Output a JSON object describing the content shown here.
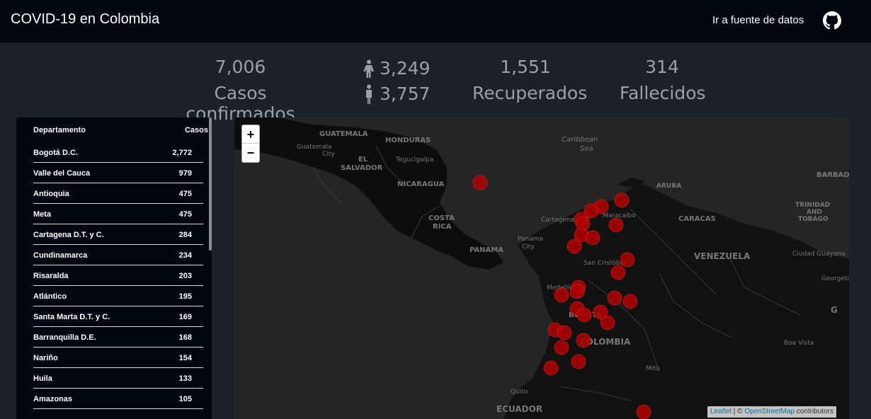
{
  "header": {
    "title": "COVID-19 en Colombia",
    "source_link": "Ir a fuente de datos",
    "github_icon": "github-icon"
  },
  "stats": {
    "confirmed": {
      "value": "7,006",
      "label": "Casos confirmados"
    },
    "female": {
      "value": "3,249",
      "icon": "female-icon"
    },
    "male": {
      "value": "3,757",
      "icon": "male-icon"
    },
    "recovered": {
      "value": "1,551",
      "label": "Recuperados"
    },
    "deaths": {
      "value": "314",
      "label": "Fallecidos"
    }
  },
  "table": {
    "headers": {
      "department": "Departamento",
      "cases": "Casos"
    },
    "rows": [
      {
        "name": "Bogotá D.C.",
        "cases": "2,772"
      },
      {
        "name": "Valle del Cauca",
        "cases": "979"
      },
      {
        "name": "Antioquia",
        "cases": "475"
      },
      {
        "name": "Meta",
        "cases": "475"
      },
      {
        "name": "Cartagena D.T. y C.",
        "cases": "284"
      },
      {
        "name": "Cundinamarca",
        "cases": "234"
      },
      {
        "name": "Risaralda",
        "cases": "203"
      },
      {
        "name": "Atlántico",
        "cases": "195"
      },
      {
        "name": "Santa Marta D.T. y C.",
        "cases": "169"
      },
      {
        "name": "Barranquilla D.E.",
        "cases": "168"
      },
      {
        "name": "Nariño",
        "cases": "154"
      },
      {
        "name": "Huila",
        "cases": "133"
      },
      {
        "name": "Amazonas",
        "cases": "105"
      }
    ]
  },
  "map": {
    "zoom_in": "+",
    "zoom_out": "−",
    "attribution_leaflet": "Leaflet",
    "attribution_sep": " | © ",
    "attribution_osm": "OpenStreetMap",
    "attribution_tail": " contributors",
    "labels": {
      "guatemala": "GUATEMALA",
      "guatemala_city": "Guatemala",
      "guatemala_city2": "City",
      "honduras": "HONDURAS",
      "tegucigalpa": "Tegucigalpa",
      "el_salvador1": "EL",
      "el_salvador2": "SALVADOR",
      "nicaragua": "NICARAGUA",
      "caribbean1": "Caribbean",
      "caribbean2": "Sea",
      "costa_rica1": "COSTA",
      "costa_rica2": "RICA",
      "panama": "PANAMA",
      "panama_city1": "Panama",
      "panama_city2": "City",
      "aruba": "ARUBA",
      "barbados": "BARBAD",
      "cartagena": "Cartagena",
      "maracaibo": "Maracaibo",
      "caracas": "CARACAS",
      "trinidad1": "TRINIDAD",
      "trinidad2": "AND",
      "trinidad3": "TOBAGO",
      "venezuela": "VENEZUELA",
      "san_cristobal": "San Cristóbal",
      "ciudad_guayana": "Ciudad Guayana",
      "georgetown": "Georgetow",
      "medellin": "Medellín",
      "bogota": "BOGOTA",
      "colombia": "COLOMBIA",
      "boa_vista": "Boa Vista",
      "g": "G",
      "mitu": "Mitú",
      "quito": "Quito",
      "ecuador": "ECUADOR"
    },
    "markers_icon": "case-marker"
  }
}
